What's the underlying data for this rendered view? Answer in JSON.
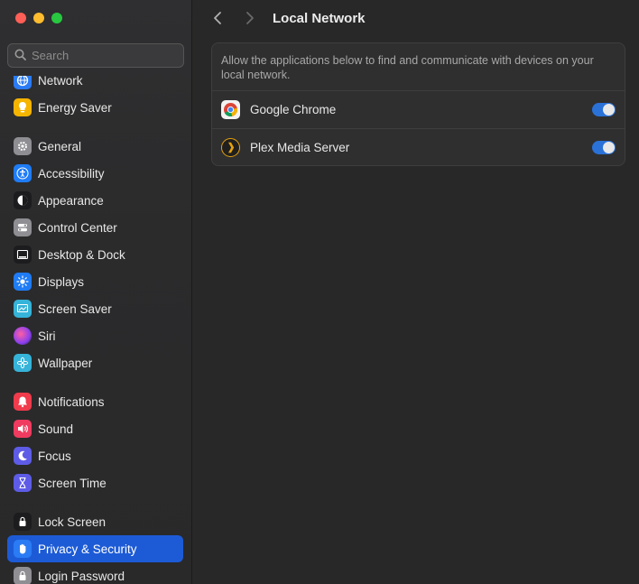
{
  "window": {
    "traffic_lights": [
      "close",
      "minimize",
      "maximize"
    ],
    "colors": {
      "close": "#ff5f57",
      "minimize": "#febc2e",
      "maximize": "#28c840"
    }
  },
  "search": {
    "placeholder": "Search",
    "value": ""
  },
  "sidebar": {
    "items": [
      {
        "label": "Network",
        "icon": "globe-icon",
        "color": "#2a7bf4"
      },
      {
        "label": "Energy Saver",
        "icon": "lightbulb-icon",
        "color": "#f5b400"
      },
      {
        "label": "General",
        "icon": "gear-icon",
        "color": "#8e8e93"
      },
      {
        "label": "Accessibility",
        "icon": "accessibility-icon",
        "color": "#1f7cf5"
      },
      {
        "label": "Appearance",
        "icon": "appearance-icon",
        "color": "#1c1c1e"
      },
      {
        "label": "Control Center",
        "icon": "control-center-icon",
        "color": "#8e8e93"
      },
      {
        "label": "Desktop & Dock",
        "icon": "dock-icon",
        "color": "#1c1c1e"
      },
      {
        "label": "Displays",
        "icon": "sun-icon",
        "color": "#1f7cf5"
      },
      {
        "label": "Screen Saver",
        "icon": "screen-saver-icon",
        "color": "#36b3d9"
      },
      {
        "label": "Siri",
        "icon": "siri-icon",
        "color": "#8a3ff0"
      },
      {
        "label": "Wallpaper",
        "icon": "flower-icon",
        "color": "#36b3d9"
      },
      {
        "label": "Notifications",
        "icon": "bell-icon",
        "color": "#ef3b4b"
      },
      {
        "label": "Sound",
        "icon": "speaker-icon",
        "color": "#ef3b5f"
      },
      {
        "label": "Focus",
        "icon": "moon-icon",
        "color": "#5e5ce6"
      },
      {
        "label": "Screen Time",
        "icon": "hourglass-icon",
        "color": "#5e5ce6"
      },
      {
        "label": "Lock Screen",
        "icon": "lock-screen-icon",
        "color": "#1c1c1e"
      },
      {
        "label": "Privacy & Security",
        "icon": "hand-icon",
        "color": "#2a7bf4"
      },
      {
        "label": "Login Password",
        "icon": "lock-icon",
        "color": "#8e8e93"
      }
    ],
    "active": "Privacy & Security",
    "accent": "#1d5bd6"
  },
  "header": {
    "title": "Local Network"
  },
  "panel": {
    "description": "Allow the applications below to find and communicate with devices on your local network.",
    "apps": [
      {
        "name": "Google Chrome",
        "icon": "chrome-icon",
        "enabled": true
      },
      {
        "name": "Plex Media Server",
        "icon": "plex-icon",
        "enabled": true
      }
    ],
    "toggle_color": "#2a72d8"
  }
}
